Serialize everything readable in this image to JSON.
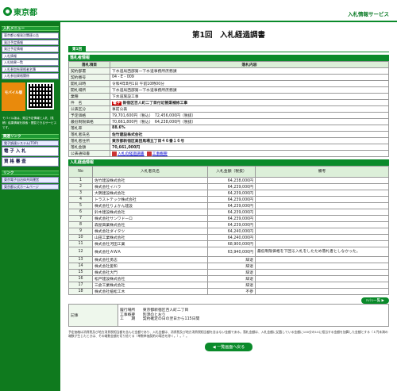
{
  "header": {
    "logo_text": "東京都",
    "service_name": "入札情報サービス"
  },
  "sidebar": {
    "menu_title": "入札メニュー",
    "menu_items": [
      "東京都公報発注関連公告",
      "発注予定情報",
      "発注予定情報",
      "入札情報",
      "入札結果一覧",
      "入札参加有資格者名簿",
      "入札参加資格関係"
    ],
    "mobile_label": "モバイル版",
    "mobile_text": "モバイル版は、発注予定情報と入札（見積）結果情報を検索・閲覧できるサービスです。",
    "links_title": "関連リンク",
    "related_links": [
      "電子調達システム(TOP)",
      "電 子 入 札",
      "資 格 審 査"
    ],
    "link_title": "リンク",
    "external_links": [
      "東京電子自治体共同運営",
      "東京都公式ホームページ"
    ]
  },
  "page": {
    "title": "第1回　入札経過調書",
    "tab": "第1回"
  },
  "info": {
    "section_title": "落札者情報",
    "col_item": "落札項目",
    "col_content": "落札内容",
    "rows": [
      {
        "k": "契約部署",
        "v": "下水道局西部第一下水道事務所庶務課"
      },
      {
        "k": "契約番号",
        "v": "04 - E - 009"
      },
      {
        "k": "開札日時",
        "v": "令和4年8月1日 午前10時00分"
      },
      {
        "k": "開札場所",
        "v": "下水道局西部第一下水道事務所庶務課"
      },
      {
        "k": "業種",
        "v": "下水道施設工事"
      },
      {
        "k": "件　名",
        "badge": "電子",
        "v": "新宿区百人町二丁目付近管渠補修工事"
      },
      {
        "k": "公表区分",
        "v": "事前公表"
      },
      {
        "k": "予定価格",
        "v": "79,701,600円（税込）　72,456,000円（税抜）"
      },
      {
        "k": "最低制限価格",
        "v": "70,661,800円（税込）　64,238,000円（税抜）"
      },
      {
        "k": "落札率",
        "v": "88.6%"
      },
      {
        "k": "落札者氏名",
        "v": "佐竹建設株式会社"
      },
      {
        "k": "落札者住所",
        "v": "東京都新宿区高田馬場五丁目４６番１６号"
      },
      {
        "k": "落札金額",
        "v": "70,661,000円"
      }
    ],
    "notice_label": "公表通知書",
    "notice_links": [
      "入札の経過調書",
      "工事概要"
    ]
  },
  "bids": {
    "section_title": "入札経過情報",
    "headers": [
      "No",
      "入札者氏名",
      "入札金額（税抜）",
      "備考"
    ],
    "rows": [
      {
        "no": "1",
        "name": "佐竹建設株式会社",
        "amt": "64,238,000円",
        "rem": ""
      },
      {
        "no": "2",
        "name": "株式会社イハラ",
        "amt": "64,239,000円",
        "rem": ""
      },
      {
        "no": "3",
        "name": "大隅建設株式会社",
        "amt": "64,239,000円",
        "rem": ""
      },
      {
        "no": "4",
        "name": "トラストテック株式会社",
        "amt": "64,239,000円",
        "rem": ""
      },
      {
        "no": "5",
        "name": "株式会社りょかん建設",
        "amt": "64,239,000円",
        "rem": ""
      },
      {
        "no": "6",
        "name": "鈴木建設株式会社",
        "amt": "64,239,000円",
        "rem": ""
      },
      {
        "no": "7",
        "name": "株式会社サンワドーロ",
        "amt": "64,239,000円",
        "rem": ""
      },
      {
        "no": "8",
        "name": "森屋興業株式会社",
        "amt": "64,239,000円",
        "rem": ""
      },
      {
        "no": "9",
        "name": "株式会社ダイタツ",
        "amt": "64,240,000円",
        "rem": ""
      },
      {
        "no": "10",
        "name": "山田工業株式会社",
        "amt": "64,240,000円",
        "rem": ""
      },
      {
        "no": "11",
        "name": "株式会社河田工業",
        "amt": "68,900,000円",
        "rem": ""
      },
      {
        "no": "12",
        "name": "株式会社ＡＷＡ",
        "amt": "63,940,000円",
        "rem": "最低制限価格を下回る入札をしたため落札者としなかった。"
      },
      {
        "no": "13",
        "name": "株式会社勇志",
        "amt": "辞退",
        "rem": ""
      },
      {
        "no": "14",
        "name": "株式会社愛和",
        "amt": "辞退",
        "rem": ""
      },
      {
        "no": "15",
        "name": "株式会社大門",
        "amt": "辞退",
        "rem": ""
      },
      {
        "no": "16",
        "name": "松戸建設株式会社",
        "amt": "辞退",
        "rem": ""
      },
      {
        "no": "17",
        "name": "三倉工業株式会社",
        "amt": "辞退",
        "rem": ""
      },
      {
        "no": "18",
        "name": "株式会社植松工木",
        "amt": "不参",
        "rem": ""
      }
    ],
    "next_button": "ﾊｯｼｭ一覧 ▶"
  },
  "notes": {
    "label": "記事",
    "lines": [
      "履行場所　　東京都新宿区百人町二丁目",
      "工事概要　　別添のとおり",
      "工　　期　　契約確定の日の翌日から115日間"
    ]
  },
  "footer_text": "予定価格は消費税及び地方消費税相当額を含んだ金額であり、入札金額は、消費税及び地方消費税相当額を含まない金額である。落札金額は、入札金額に記載している金額に100分の10に相当する金額を加算した金額とする（１円未満の端数が生じたときは、その端数金額を切り捨てる（単数単価契約の場合を除く。）。）。",
  "back_button": "◀ 一覧画面へ戻る"
}
